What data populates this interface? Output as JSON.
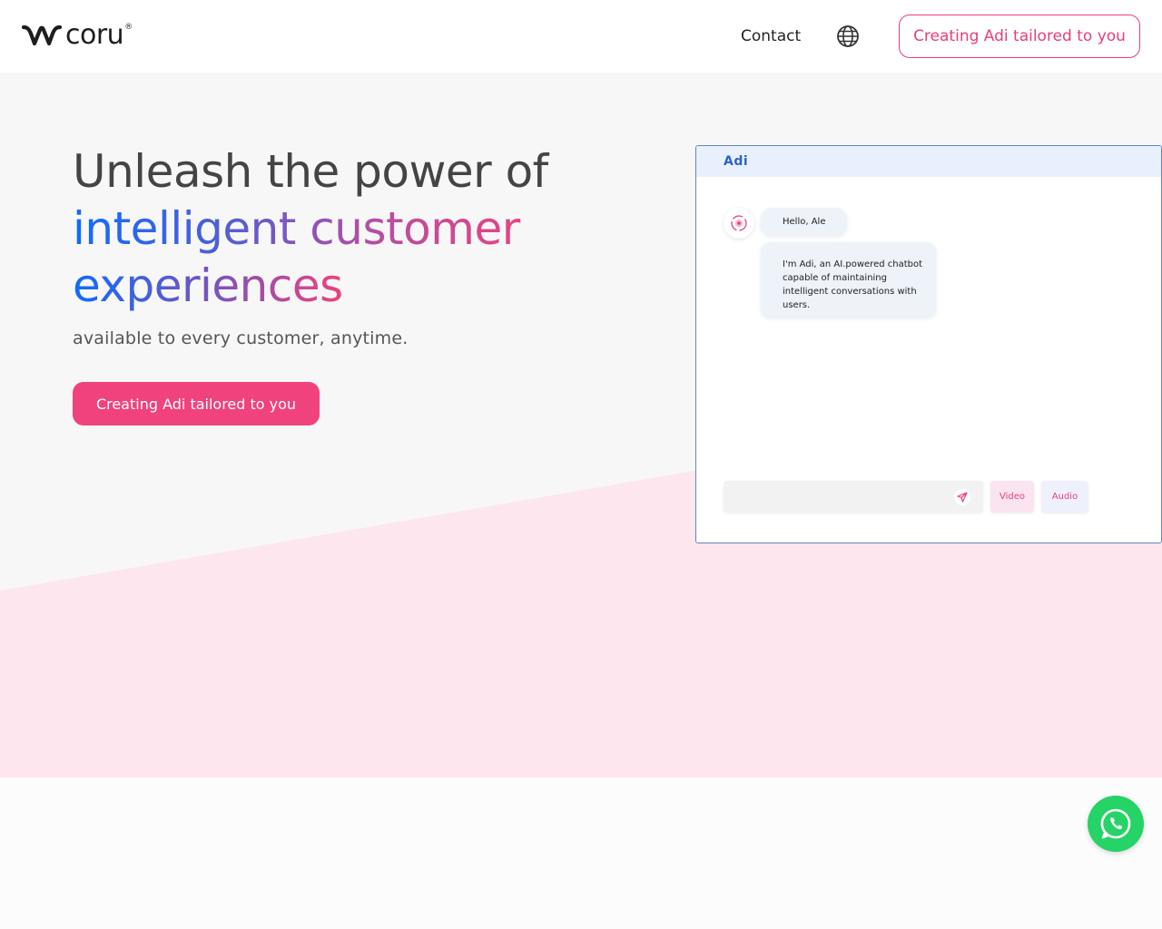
{
  "brand": {
    "name": "coru",
    "registered_mark": "®",
    "accent_color": "#f0427c"
  },
  "nav": {
    "contact_label": "Contact",
    "language_icon": "globe-icon",
    "cta_label": "Creating Adi tailored to you"
  },
  "hero": {
    "headline_line1": "Unleash the power of",
    "headline_line2": "intelligent customer",
    "headline_line3": "experiences",
    "subline": "available to every customer, anytime.",
    "cta_label": "Creating Adi tailored to you",
    "gradient_colors": [
      "#0f6bff",
      "#f0417e"
    ],
    "background_pink": "#fde6ee"
  },
  "chat": {
    "title": "Adi",
    "avatar_icon": "bot-avatar-icon",
    "messages": [
      "Hello, Ale",
      "I'm Adi, an AI.powered chatbot capable of maintaining intelligent conversations with users."
    ],
    "input_value": "",
    "send_icon": "send-icon",
    "video_label": "Video",
    "audio_label": "Audio"
  },
  "floating": {
    "whatsapp_icon": "whatsapp-icon",
    "whatsapp_color": "#25d366"
  }
}
